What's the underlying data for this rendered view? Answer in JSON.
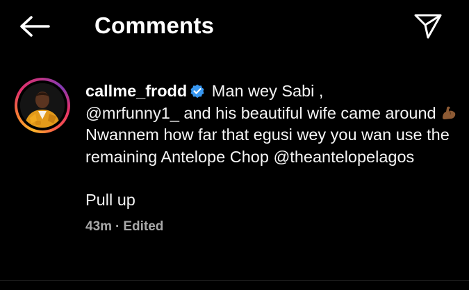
{
  "header": {
    "back_icon": "arrow-left-icon",
    "title": "Comments",
    "share_icon": "paper-plane-icon"
  },
  "comment": {
    "avatar": "profile-photo",
    "username": "callme_frodd",
    "verified_icon": "verified-badge-icon",
    "text_1": " Man wey Sabi ,",
    "mention_1": "@mrfunny1_",
    "text_2": " and his beautiful wife came around ",
    "emoji": "flexed-biceps-emoji",
    "text_3": "Nwannem how far that egusi wey you wan use the remaining Antelope Chop ",
    "mention_2": "@theantelopelagos",
    "text_4": "Pull up",
    "time": "43m",
    "separator": "·",
    "edited": "Edited"
  },
  "colors": {
    "background": "#000000",
    "text": "#f5f5f5",
    "meta": "#a8a8a8",
    "verified_blue": "#3897f0"
  }
}
